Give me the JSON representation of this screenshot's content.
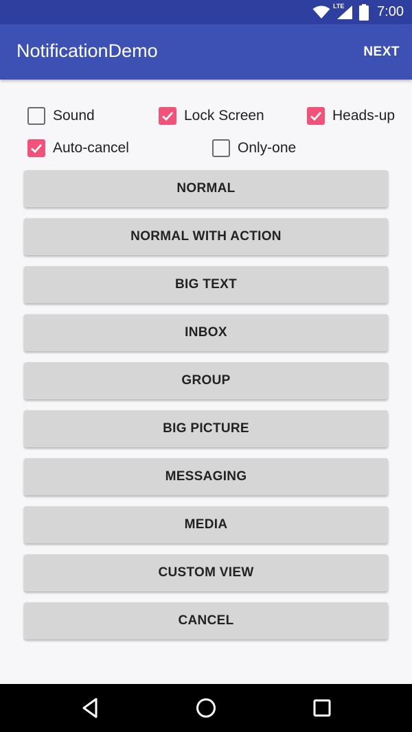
{
  "status_bar": {
    "time": "7:00",
    "network_label": "LTE",
    "icons": [
      "wifi-icon",
      "signal-icon",
      "battery-icon"
    ]
  },
  "app_bar": {
    "title": "NotificationDemo",
    "action_label": "NEXT"
  },
  "options": [
    {
      "label": "Sound",
      "checked": false
    },
    {
      "label": "Lock Screen",
      "checked": true
    },
    {
      "label": "Heads-up",
      "checked": true
    },
    {
      "label": "Auto-cancel",
      "checked": true
    },
    {
      "label": "Only-one",
      "checked": false
    }
  ],
  "buttons": [
    {
      "label": "NORMAL"
    },
    {
      "label": "NORMAL WITH ACTION"
    },
    {
      "label": "BIG TEXT"
    },
    {
      "label": "INBOX"
    },
    {
      "label": "GROUP"
    },
    {
      "label": "BIG PICTURE"
    },
    {
      "label": "MESSAGING"
    },
    {
      "label": "MEDIA"
    },
    {
      "label": "CUSTOM VIEW"
    },
    {
      "label": "CANCEL"
    }
  ],
  "nav_bar": {
    "icons": [
      "back-icon",
      "home-icon",
      "recents-icon"
    ]
  },
  "colors": {
    "status_bar": "#2f3f9f",
    "app_bar": "#3d51b5",
    "checkbox_accent": "#f0527a",
    "button": "#d6d6d6",
    "background": "#f7f6f8"
  }
}
